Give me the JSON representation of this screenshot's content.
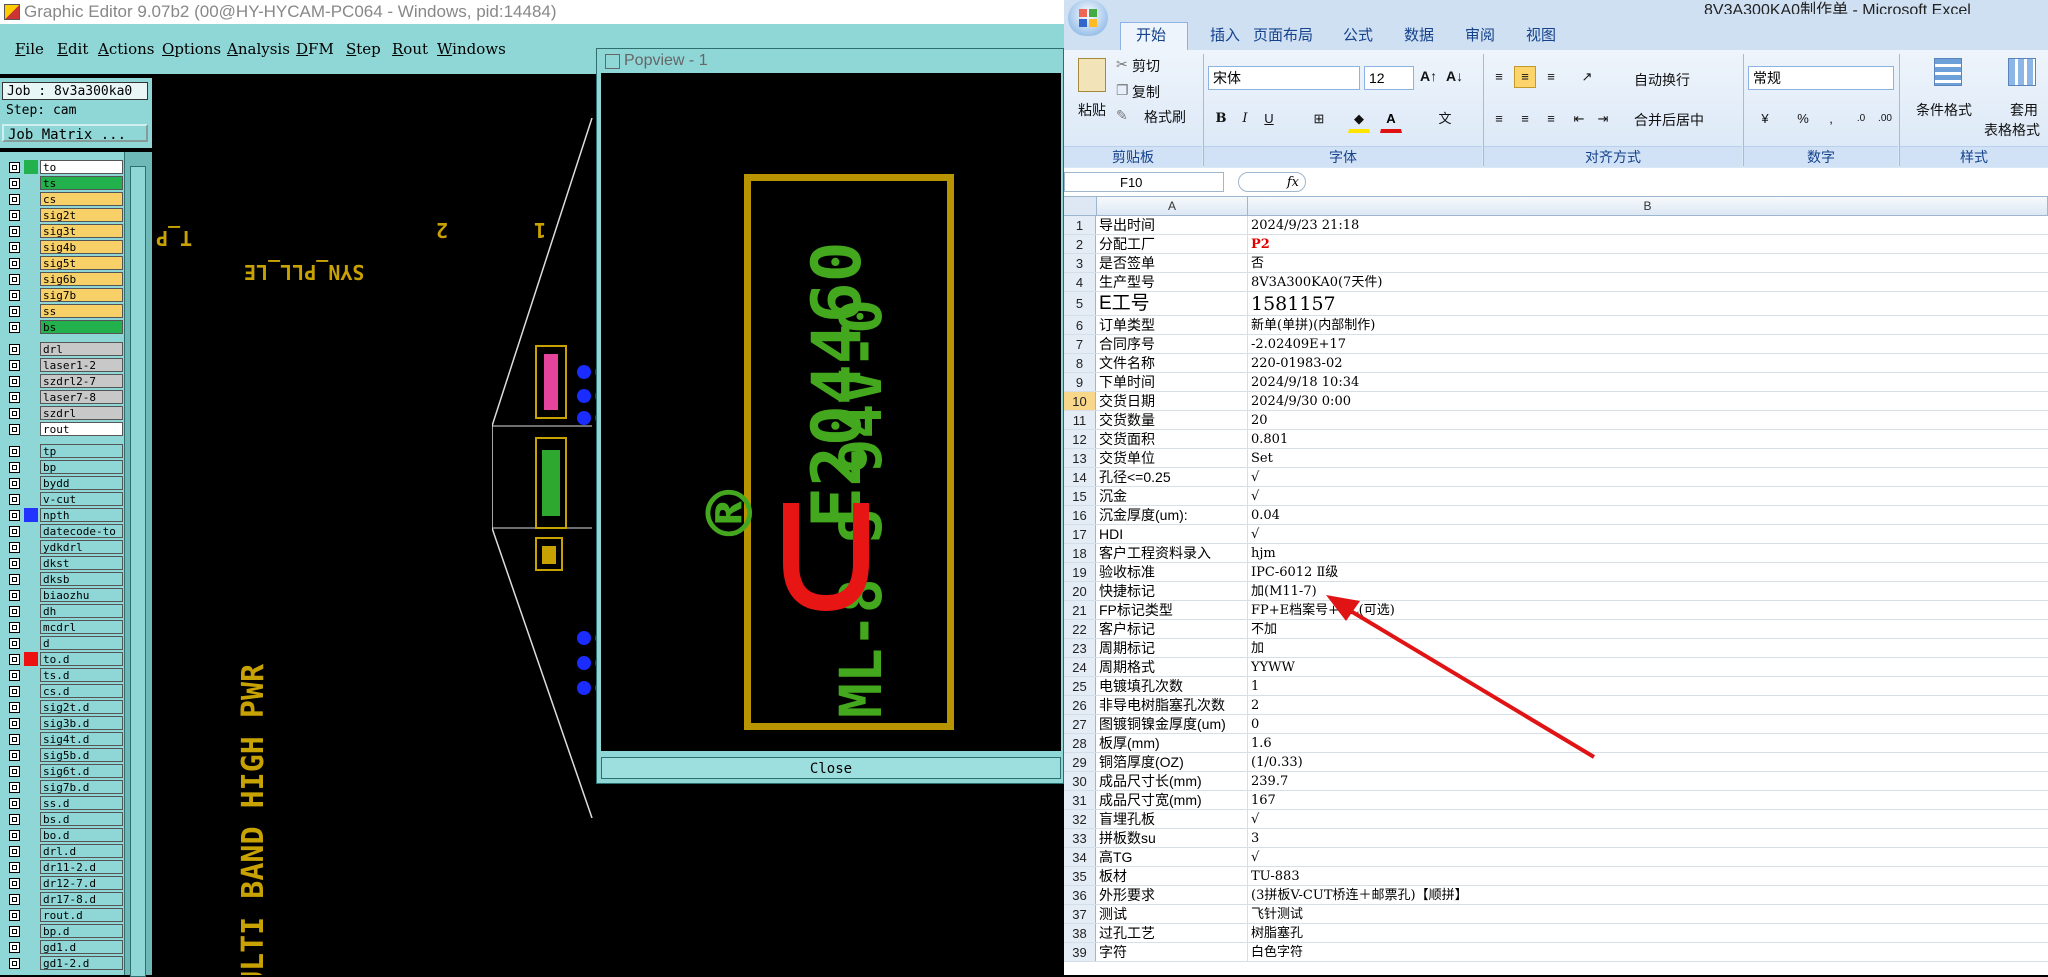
{
  "editor": {
    "title": "Graphic Editor 9.07b2 (00@HY-HYCAM-PC064 - Windows, pid:14484)",
    "menu": [
      "File",
      "Edit",
      "Actions",
      "Options",
      "Analysis",
      "DFM",
      "Step",
      "Rout",
      "Windows"
    ],
    "job_label": "Job : 8v3a300ka0",
    "step_label": "Step: cam",
    "job_matrix_label": "Job Matrix ...",
    "layers": [
      {
        "name": "to",
        "fill": "#ffffff",
        "swatch": "#22b14c"
      },
      {
        "name": "ts",
        "fill": "#22b14c",
        "swatch": ""
      },
      {
        "name": "cs",
        "fill": "#f7d168",
        "swatch": ""
      },
      {
        "name": "sig2t",
        "fill": "#f7d168",
        "swatch": ""
      },
      {
        "name": "sig3t",
        "fill": "#f7d168",
        "swatch": ""
      },
      {
        "name": "sig4b",
        "fill": "#f7d168",
        "swatch": ""
      },
      {
        "name": "sig5t",
        "fill": "#f7d168",
        "swatch": ""
      },
      {
        "name": "sig6b",
        "fill": "#f7d168",
        "swatch": ""
      },
      {
        "name": "sig7b",
        "fill": "#f7d168",
        "swatch": ""
      },
      {
        "name": "ss",
        "fill": "#f7d168",
        "swatch": ""
      },
      {
        "name": "bs",
        "fill": "#22b14c",
        "swatch": ""
      },
      {
        "name": "drl",
        "fill": "#c8c8c8",
        "swatch": ""
      },
      {
        "name": "laser1-2",
        "fill": "#c8c8c8",
        "swatch": ""
      },
      {
        "name": "szdrl2-7",
        "fill": "#c8c8c8",
        "swatch": ""
      },
      {
        "name": "laser7-8",
        "fill": "#c8c8c8",
        "swatch": ""
      },
      {
        "name": "szdrl",
        "fill": "#c8c8c8",
        "swatch": ""
      },
      {
        "name": "rout",
        "fill": "#ffffff",
        "swatch": ""
      },
      {
        "name": "tp",
        "fill": "",
        "swatch": ""
      },
      {
        "name": "bp",
        "fill": "",
        "swatch": ""
      },
      {
        "name": "bydd",
        "fill": "",
        "swatch": ""
      },
      {
        "name": "v-cut",
        "fill": "",
        "swatch": ""
      },
      {
        "name": "npth",
        "fill": "",
        "swatch": "#2233ff"
      },
      {
        "name": "datecode-to",
        "fill": "",
        "swatch": ""
      },
      {
        "name": "ydkdrl",
        "fill": "",
        "swatch": ""
      },
      {
        "name": "dkst",
        "fill": "",
        "swatch": ""
      },
      {
        "name": "dksb",
        "fill": "",
        "swatch": ""
      },
      {
        "name": "biaozhu",
        "fill": "",
        "swatch": ""
      },
      {
        "name": "dh",
        "fill": "",
        "swatch": ""
      },
      {
        "name": "mcdrl",
        "fill": "",
        "swatch": ""
      },
      {
        "name": "d",
        "fill": "",
        "swatch": ""
      },
      {
        "name": "to.d",
        "fill": "",
        "swatch": "#ee1111"
      },
      {
        "name": "ts.d",
        "fill": "",
        "swatch": ""
      },
      {
        "name": "cs.d",
        "fill": "",
        "swatch": ""
      },
      {
        "name": "sig2t.d",
        "fill": "",
        "swatch": ""
      },
      {
        "name": "sig3b.d",
        "fill": "",
        "swatch": ""
      },
      {
        "name": "sig4t.d",
        "fill": "",
        "swatch": ""
      },
      {
        "name": "sig5b.d",
        "fill": "",
        "swatch": ""
      },
      {
        "name": "sig6t.d",
        "fill": "",
        "swatch": ""
      },
      {
        "name": "sig7b.d",
        "fill": "",
        "swatch": ""
      },
      {
        "name": "ss.d",
        "fill": "",
        "swatch": ""
      },
      {
        "name": "bs.d",
        "fill": "",
        "swatch": ""
      },
      {
        "name": "bo.d",
        "fill": "",
        "swatch": ""
      },
      {
        "name": "drl.d",
        "fill": "",
        "swatch": ""
      },
      {
        "name": "dr11-2.d",
        "fill": "",
        "swatch": ""
      },
      {
        "name": "dr12-7.d",
        "fill": "",
        "swatch": ""
      },
      {
        "name": "dr17-8.d",
        "fill": "",
        "swatch": ""
      },
      {
        "name": "rout.d",
        "fill": "",
        "swatch": ""
      },
      {
        "name": "bp.d",
        "fill": "",
        "swatch": ""
      },
      {
        "name": "gd1.d",
        "fill": "",
        "swatch": ""
      },
      {
        "name": "gd1-2.d",
        "fill": "",
        "swatch": ""
      }
    ],
    "canvas_texts": {
      "syn": "SYN_PLL_LE",
      "tp": "T_P",
      "n2": "2",
      "n1": "1",
      "multi": "MULTI BAND HIGH PWR"
    }
  },
  "popview": {
    "title": "Popview - 1",
    "line1": "E204460",
    "line2": "ML-8 S 94V-0",
    "registered": "®",
    "close_label": "Close"
  },
  "excel": {
    "title": "8V3A300KA0制作单 - Microsoft Excel",
    "tabs": [
      "开始",
      "插入",
      "页面布局",
      "公式",
      "数据",
      "审阅",
      "视图"
    ],
    "clipboard": {
      "paste": "粘贴",
      "cut": "剪切",
      "copy": "复制",
      "format_painter": "格式刷",
      "label": "剪贴板"
    },
    "font": {
      "name": "宋体",
      "size": "12",
      "label": "字体",
      "bold": "B",
      "italic": "I",
      "underline": "U"
    },
    "alignment": {
      "wrap": "自动换行",
      "merge": "合并后居中",
      "label": "对齐方式"
    },
    "number": {
      "format": "常规",
      "label": "数字",
      "percent": "%",
      "comma": ","
    },
    "styles": {
      "conditional": "条件格式",
      "table": "套用",
      "table2": "表格格式",
      "label": "样式"
    },
    "name_box": "F10",
    "fx": "fx",
    "columns": [
      "A",
      "B"
    ],
    "rows": [
      {
        "n": "1",
        "a": "导出时间",
        "b": "2024/9/23 21:18"
      },
      {
        "n": "2",
        "a": "分配工厂",
        "b": "P2",
        "b_color": "#e00000"
      },
      {
        "n": "3",
        "a": "是否签单",
        "b": "否"
      },
      {
        "n": "4",
        "a": "生产型号",
        "b": "8V3A300KA0(7天件)"
      },
      {
        "n": "5",
        "a": "E工号",
        "b": "1581157",
        "big": true
      },
      {
        "n": "6",
        "a": "订单类型",
        "b": "新单(单拼)(内部制作)"
      },
      {
        "n": "7",
        "a": "合同序号",
        "b": "-2.02409E+17"
      },
      {
        "n": "8",
        "a": "文件名称",
        "b": "220-01983-02"
      },
      {
        "n": "9",
        "a": "下单时间",
        "b": "2024/9/18 10:34"
      },
      {
        "n": "10",
        "a": "交货日期",
        "b": "2024/9/30 0:00",
        "sel": true
      },
      {
        "n": "11",
        "a": "交货数量",
        "b": "20"
      },
      {
        "n": "12",
        "a": "交货面积",
        "b": "0.801"
      },
      {
        "n": "13",
        "a": "交货单位",
        "b": "Set"
      },
      {
        "n": "14",
        "a": "孔径<=0.25",
        "b": "√"
      },
      {
        "n": "15",
        "a": "沉金",
        "b": "√"
      },
      {
        "n": "16",
        "a": "沉金厚度(um):",
        "b": "0.04"
      },
      {
        "n": "17",
        "a": "HDI",
        "b": "√"
      },
      {
        "n": "18",
        "a": "客户工程资料录入",
        "b": "hjm"
      },
      {
        "n": "19",
        "a": "验收标准",
        "b": "IPC-6012 Ⅱ级"
      },
      {
        "n": "20",
        "a": "快捷标记",
        "b": "加(M11-7)"
      },
      {
        "n": "21",
        "a": "FP标记类型",
        "b": "FP+E档案号+UL(可选)"
      },
      {
        "n": "22",
        "a": "客户标记",
        "b": "不加"
      },
      {
        "n": "23",
        "a": "周期标记",
        "b": "加"
      },
      {
        "n": "24",
        "a": "周期格式",
        "b": "YYWW"
      },
      {
        "n": "25",
        "a": "电镀填孔次数",
        "b": "1"
      },
      {
        "n": "26",
        "a": "非导电树脂塞孔次数",
        "b": "2"
      },
      {
        "n": "27",
        "a": "图镀铜镍金厚度(um)",
        "b": "0"
      },
      {
        "n": "28",
        "a": "板厚(mm)",
        "b": "1.6"
      },
      {
        "n": "29",
        "a": "铜箔厚度(OZ)",
        "b": "(1/0.33)"
      },
      {
        "n": "30",
        "a": "成品尺寸长(mm)",
        "b": "239.7"
      },
      {
        "n": "31",
        "a": "成品尺寸宽(mm)",
        "b": "167"
      },
      {
        "n": "32",
        "a": "盲埋孔板",
        "b": "√"
      },
      {
        "n": "33",
        "a": "拼板数su",
        "b": "3"
      },
      {
        "n": "34",
        "a": "高TG",
        "b": "√"
      },
      {
        "n": "35",
        "a": "板材",
        "b": "TU-883"
      },
      {
        "n": "36",
        "a": "外形要求",
        "b": "(3拼板V-CUT桥连＋邮票孔)【顺拼】"
      },
      {
        "n": "37",
        "a": "测试",
        "b": "飞针测试"
      },
      {
        "n": "38",
        "a": "过孔工艺",
        "b": "树脂塞孔"
      },
      {
        "n": "39",
        "a": "字符",
        "b": "白色字符"
      }
    ]
  }
}
